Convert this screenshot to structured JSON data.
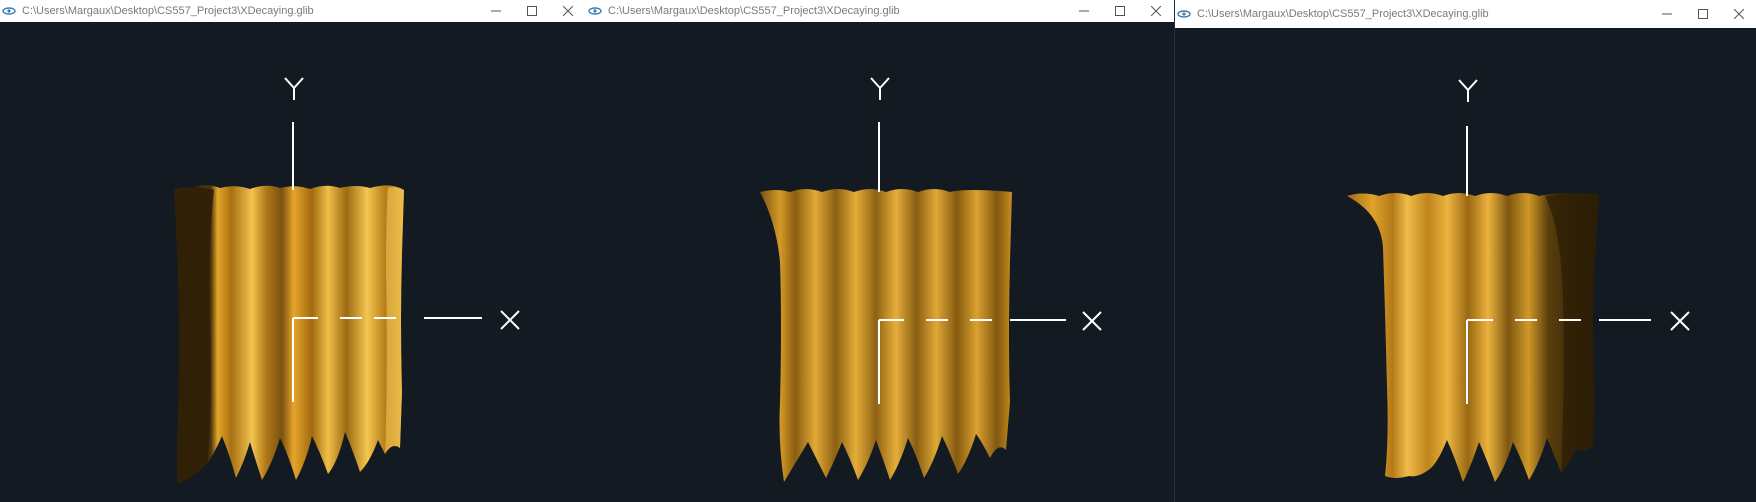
{
  "windows": [
    {
      "title": "C:\\Users\\Margaux\\Desktop\\CS557_Project3\\XDecaying.glib",
      "controls": {
        "minimize": "—",
        "maximize": "☐",
        "close": "✕"
      },
      "icon": "glib-eye-icon",
      "axes": {
        "y_label": "Y",
        "x_label": "X"
      }
    },
    {
      "title": "C:\\Users\\Margaux\\Desktop\\CS557_Project3\\XDecaying.glib",
      "controls": {
        "minimize": "—",
        "maximize": "☐",
        "close": "✕"
      },
      "icon": "glib-eye-icon",
      "axes": {
        "y_label": "Y",
        "x_label": "X"
      }
    },
    {
      "title": "C:\\Users\\Margaux\\Desktop\\CS557_Project3\\XDecaying.glib",
      "controls": {
        "minimize": "—",
        "maximize": "☐",
        "close": "✕"
      },
      "icon": "glib-eye-icon",
      "axes": {
        "y_label": "Y",
        "x_label": "X"
      }
    }
  ],
  "colors": {
    "viewport_bg": "#131a21",
    "surface_gold": "#c8901e",
    "surface_dark": "#3a2808",
    "axis": "#ffffff"
  }
}
